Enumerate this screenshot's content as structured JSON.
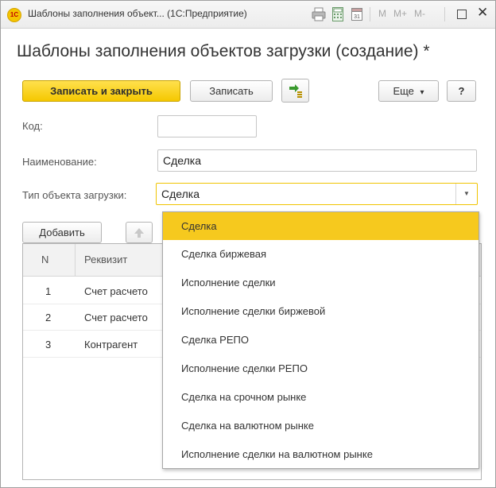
{
  "window": {
    "logo_text": "1С",
    "title": "Шаблоны заполнения объект... (1С:Предприятие)",
    "calendar_day": "31",
    "m_labels": [
      "M",
      "M+",
      "M-"
    ]
  },
  "form": {
    "title": "Шаблоны заполнения объектов загрузки (создание) *",
    "toolbar": {
      "save_close": "Записать и закрыть",
      "save": "Записать",
      "more": "Еще",
      "more_arrow": "▾",
      "help": "?"
    },
    "fields": {
      "code_label": "Код:",
      "code_value": "",
      "name_label": "Наименование:",
      "name_value": "Сделка",
      "type_label": "Тип объекта загрузки:",
      "type_value": "Сделка",
      "type_arrow": "▼"
    },
    "table_toolbar": {
      "add": "Добавить"
    },
    "table": {
      "columns": [
        "N",
        "Реквизит"
      ],
      "rows": [
        {
          "n": "1",
          "attr": "Счет расчето"
        },
        {
          "n": "2",
          "attr": "Счет расчето"
        },
        {
          "n": "3",
          "attr": "Контрагент"
        }
      ]
    }
  },
  "dropdown": {
    "selected_index": 0,
    "items": [
      "Сделка",
      "Сделка биржевая",
      "Исполнение сделки",
      "Исполнение сделки биржевой",
      "Сделка РЕПО",
      "Исполнение сделки РЕПО",
      "Сделка на срочном рынке",
      "Сделка на валютном рынке",
      "Исполнение сделки на валютном рынке"
    ]
  },
  "colors": {
    "accent": "#f5c800",
    "selected": "#f6c91e"
  }
}
